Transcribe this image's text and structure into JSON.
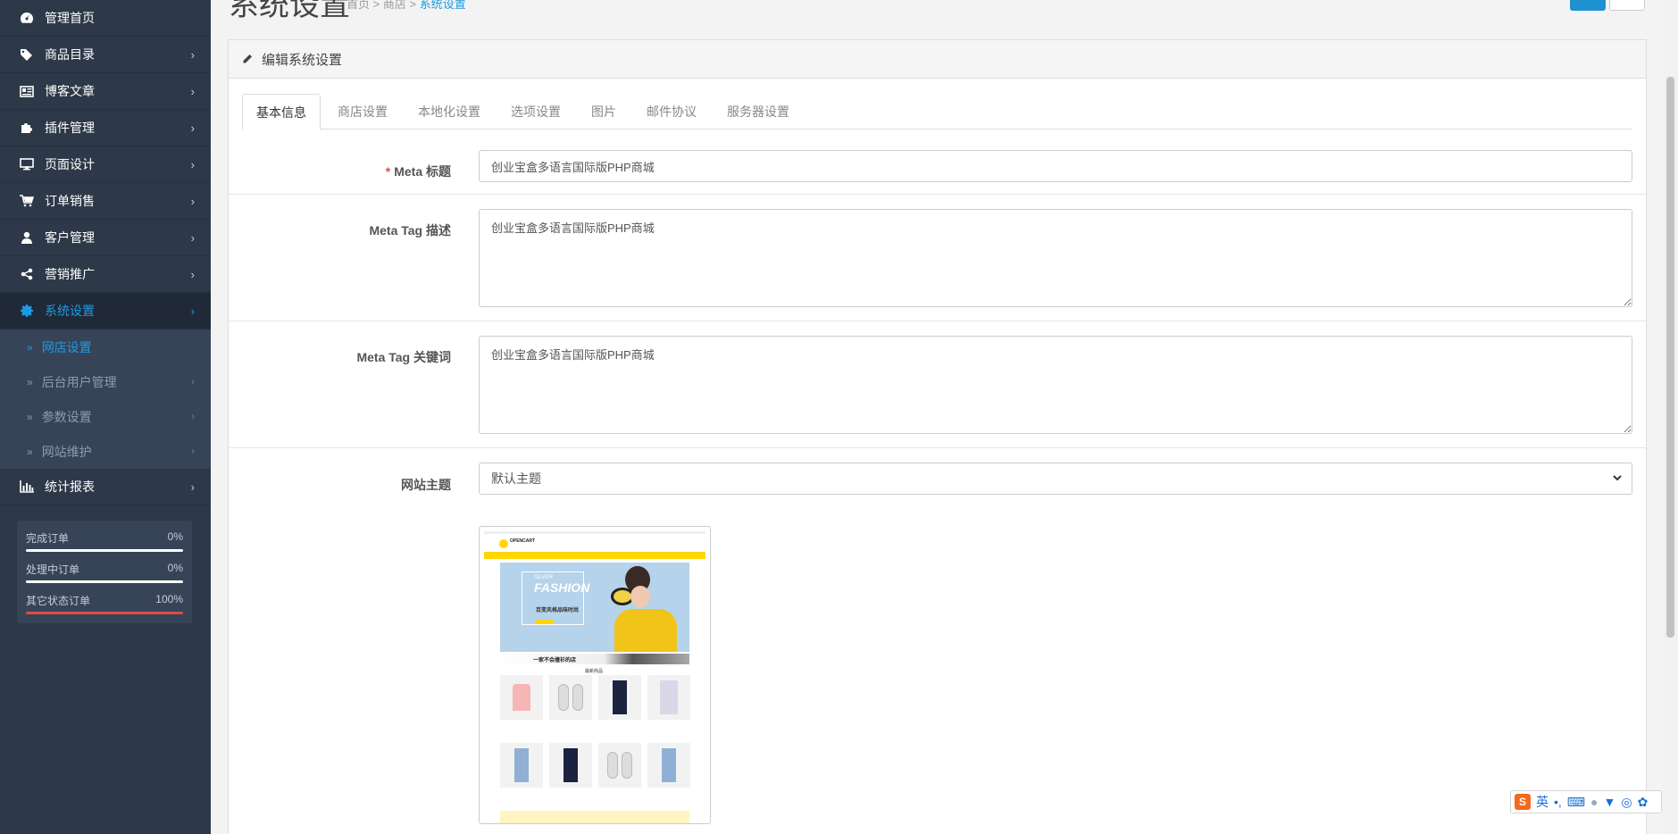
{
  "sidebar": {
    "items": [
      {
        "label": "管理首页",
        "icon": "dashboard-icon"
      },
      {
        "label": "商品目录",
        "icon": "tags-icon"
      },
      {
        "label": "博客文章",
        "icon": "newspaper-icon"
      },
      {
        "label": "插件管理",
        "icon": "puzzle-icon"
      },
      {
        "label": "页面设计",
        "icon": "desktop-icon"
      },
      {
        "label": "订单销售",
        "icon": "cart-icon"
      },
      {
        "label": "客户管理",
        "icon": "user-icon"
      },
      {
        "label": "营销推广",
        "icon": "share-icon"
      },
      {
        "label": "系统设置",
        "icon": "gear-icon"
      }
    ],
    "sub_items": [
      {
        "label": "网店设置"
      },
      {
        "label": "后台用户管理"
      },
      {
        "label": "参数设置"
      },
      {
        "label": "网站维护"
      }
    ],
    "report": {
      "label": "统计报表",
      "icon": "bar-chart-icon"
    },
    "stats": [
      {
        "label": "完成订单",
        "percent": "0%",
        "fraction": 0
      },
      {
        "label": "处理中订单",
        "percent": "0%",
        "fraction": 0
      },
      {
        "label": "其它状态订单",
        "percent": "100%",
        "fraction": 1
      }
    ]
  },
  "header": {
    "title": "系统设置",
    "breadcrumbs": [
      "首页",
      "商店",
      "系统设置"
    ],
    "breadcrumb_sep": ">"
  },
  "panel": {
    "heading": "编辑系统设置",
    "tabs": [
      "基本信息",
      "商店设置",
      "本地化设置",
      "选项设置",
      "图片",
      "邮件协议",
      "服务器设置"
    ],
    "fields": {
      "meta_title": {
        "label": "Meta 标题",
        "required_mark": "*",
        "value": "创业宝盒多语言国际版PHP商城"
      },
      "meta_description": {
        "label": "Meta Tag 描述",
        "value": "创业宝盒多语言国际版PHP商城"
      },
      "meta_keywords": {
        "label": "Meta Tag 关键词",
        "value": "创业宝盒多语言国际版PHP商城"
      },
      "theme": {
        "label": "网站主题",
        "value": "默认主题"
      }
    }
  },
  "theme_preview": {
    "logo": "OPENCART",
    "hero_title": "FASHION",
    "hero_sub": "SILVER",
    "hero_text": "百变风格品味时尚",
    "banner_text": "一家不会撞衫的店",
    "section_title": "最新商品"
  },
  "ime": {
    "lang": "英",
    "logo": "S"
  },
  "colors": {
    "sidebar_bg": "#2d3848",
    "accent": "#1e9be0",
    "danger": "#e04b4b",
    "theme_yellow": "#ffd600",
    "hero_blue": "#b5d3ea"
  }
}
